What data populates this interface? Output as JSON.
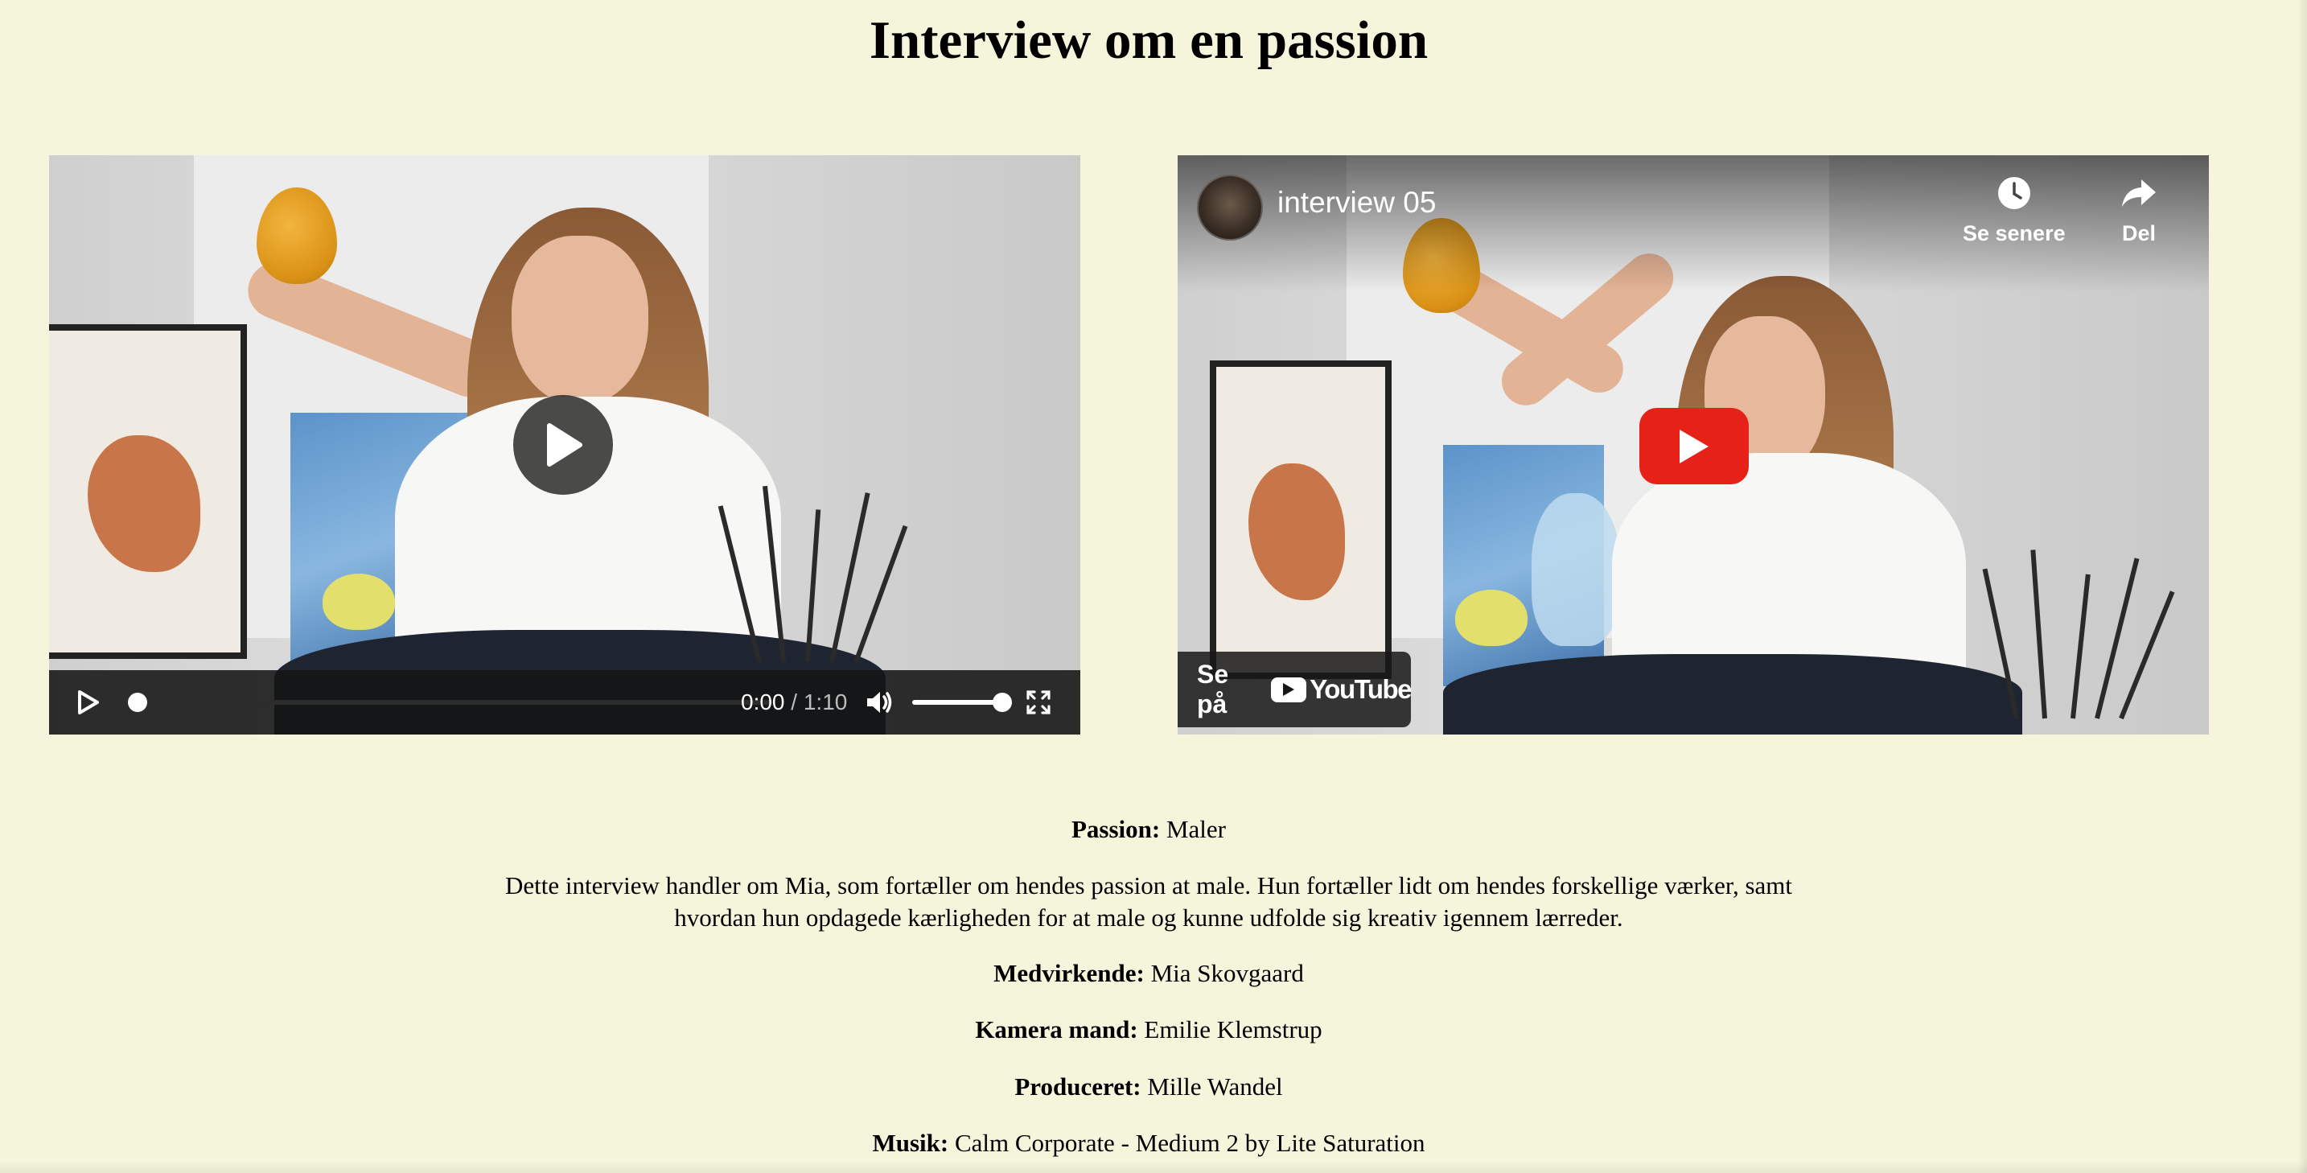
{
  "page": {
    "title": "Interview om en passion",
    "background_color": "#f5f5dc"
  },
  "video_left": {
    "type": "html5-video",
    "time_current": "0:00",
    "time_separator": " / ",
    "time_total": "1:10",
    "progress_fraction": 0.0,
    "volume_fraction": 1.0,
    "icons": [
      "play-icon",
      "volume-icon",
      "fullscreen-icon"
    ]
  },
  "video_right": {
    "type": "youtube-embed",
    "title": "interview 05",
    "watch_later_label": "Se senere",
    "share_label": "Del",
    "watch_on_label": "Se på",
    "youtube_logo_text": "YouTube",
    "play_button_color": "#e62117",
    "icons": [
      "clock-icon",
      "share-arrow-icon",
      "youtube-play-icon",
      "youtube-logo-icon"
    ]
  },
  "info": {
    "passion_label": "Passion:",
    "passion_value": " Maler",
    "description": "Dette interview handler om Mia, som fortæller om hendes passion at male. Hun fortæller lidt om hendes forskellige værker, samt hvordan hun opdagede kærligheden for at male og kunne udfolde sig kreativ igennem lærreder.",
    "medvirkende_label": "Medvirkende:",
    "medvirkende_value": " Mia Skovgaard",
    "kamera_label": "Kamera mand:",
    "kamera_value": " Emilie Klemstrup",
    "produceret_label": "Produceret:",
    "produceret_value": " Mille Wandel",
    "musik_label": "Musik:",
    "musik_value": " Calm Corporate - Medium 2 by Lite Saturation"
  }
}
